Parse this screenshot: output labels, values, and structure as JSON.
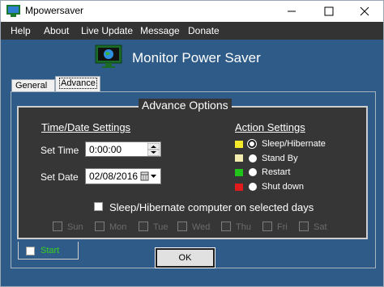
{
  "window": {
    "title": "Mpowersaver"
  },
  "menu": [
    "Help",
    "About",
    "Live Update",
    "Message",
    "Donate"
  ],
  "header": {
    "title": "Monitor Power Saver"
  },
  "tabs": [
    {
      "label": "General",
      "selected": false
    },
    {
      "label": "Advance",
      "selected": true
    }
  ],
  "advance": {
    "group_title": "Advance Options",
    "time_date": {
      "title": "Time/Date Settings",
      "set_time_label": "Set Time",
      "set_time_value": "0:00:00",
      "set_date_label": "Set Date",
      "set_date_value": "02/08/2016"
    },
    "action": {
      "title": "Action Settings",
      "options": [
        {
          "label": "Sleep/Hibernate",
          "color": "#f5ea2a",
          "selected": true
        },
        {
          "label": "Stand By",
          "color": "#f3ecb0",
          "selected": false
        },
        {
          "label": "Restart",
          "color": "#22c41c",
          "selected": false
        },
        {
          "label": "Shut down",
          "color": "#e01b1b",
          "selected": false
        }
      ]
    },
    "selected_days_label": "Sleep/Hibernate computer on selected days",
    "days": [
      "Sun",
      "Mon",
      "Tue",
      "Wed",
      "Thu",
      "Fri",
      "Sat"
    ]
  },
  "start_label": "Start",
  "ok_label": "OK",
  "colors": {
    "window_bg": "#2e5b88",
    "panel_bg": "#363636",
    "start_green": "#39d01c"
  }
}
